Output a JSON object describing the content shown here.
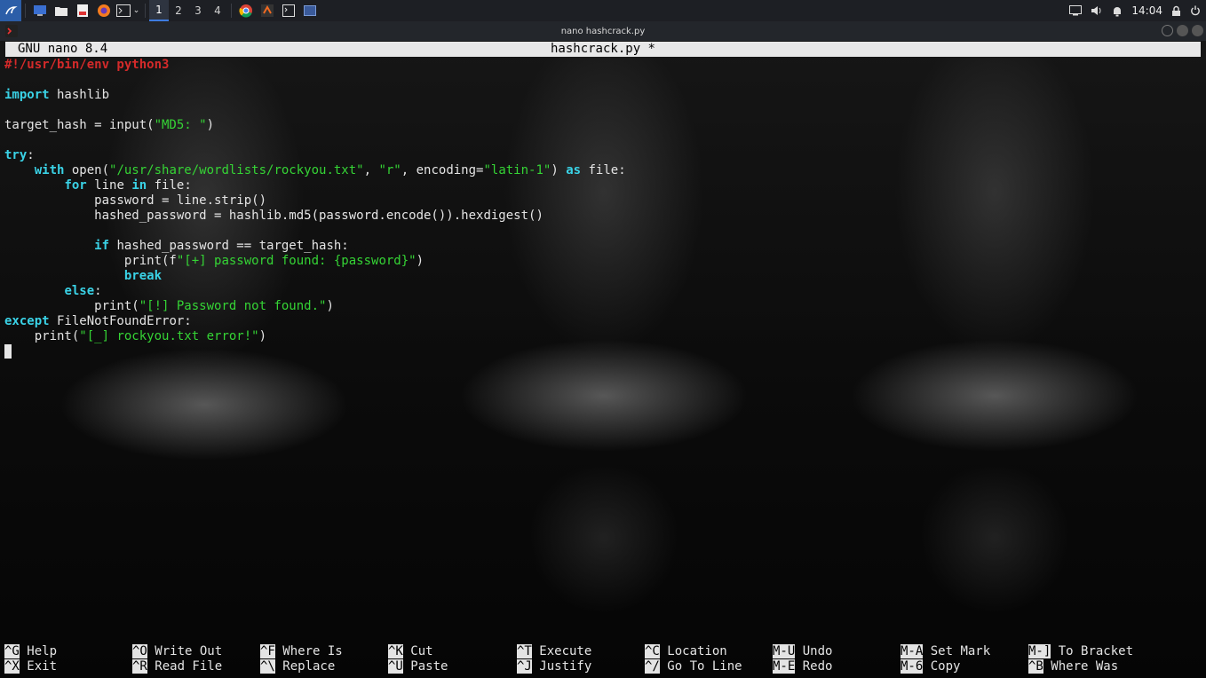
{
  "taskbar": {
    "workspaces": [
      "1",
      "2",
      "3",
      "4"
    ],
    "active_workspace": "1",
    "clock": "14:04"
  },
  "window": {
    "title": "nano hashcrack.py"
  },
  "nano": {
    "version": "GNU nano 8.4",
    "filename": "hashcrack.py *",
    "code": {
      "l1": "#!/usr/bin/env python3",
      "l3_kw": "import",
      "l3_rest": " hashlib",
      "l5_a": "target_hash = input(",
      "l5_str": "\"MD5: \"",
      "l5_b": ")",
      "l7_kw": "try",
      "l7_b": ":",
      "l8_ind": "    ",
      "l8_kw": "with",
      "l8_a": " open(",
      "l8_str1": "\"/usr/share/wordlists/rockyou.txt\"",
      "l8_b": ", ",
      "l8_str2": "\"r\"",
      "l8_c": ", encoding=",
      "l8_str3": "\"latin-1\"",
      "l8_d": ") ",
      "l8_kw2": "as",
      "l8_e": " file:",
      "l9_ind": "        ",
      "l9_kw": "for",
      "l9_a": " line ",
      "l9_kw2": "in",
      "l9_b": " file:",
      "l10": "            password = line.strip()",
      "l11": "            hashed_password = hashlib.md5(password.encode()).hexdigest()",
      "l13_ind": "            ",
      "l13_kw": "if",
      "l13_a": " hashed_password == target_hash:",
      "l14_a": "                print(f",
      "l14_str": "\"[+] password found: {password}\"",
      "l14_b": ")",
      "l15_ind": "                ",
      "l15_kw": "break",
      "l16_ind": "        ",
      "l16_kw": "else",
      "l16_a": ":",
      "l17_a": "            print(",
      "l17_str": "\"[!] Password not found.\"",
      "l17_b": ")",
      "l18_kw": "except",
      "l18_a": " FileNotFoundError:",
      "l19_a": "    print(",
      "l19_str": "\"[_] rockyou.txt error!\"",
      "l19_b": ")"
    },
    "shortcuts": [
      {
        "key": "^G",
        "label": " Help"
      },
      {
        "key": "^O",
        "label": " Write Out"
      },
      {
        "key": "^F",
        "label": " Where Is"
      },
      {
        "key": "^K",
        "label": " Cut"
      },
      {
        "key": "^T",
        "label": " Execute"
      },
      {
        "key": "^C",
        "label": " Location"
      },
      {
        "key": "M-U",
        "label": " Undo"
      },
      {
        "key": "M-A",
        "label": " Set Mark"
      },
      {
        "key": "M-]",
        "label": " To Bracket"
      },
      {
        "key": "^X",
        "label": " Exit"
      },
      {
        "key": "^R",
        "label": " Read File"
      },
      {
        "key": "^\\",
        "label": " Replace"
      },
      {
        "key": "^U",
        "label": " Paste"
      },
      {
        "key": "^J",
        "label": " Justify"
      },
      {
        "key": "^/",
        "label": " Go To Line"
      },
      {
        "key": "M-E",
        "label": " Redo"
      },
      {
        "key": "M-6",
        "label": " Copy"
      },
      {
        "key": "^B",
        "label": " Where Was"
      }
    ]
  }
}
